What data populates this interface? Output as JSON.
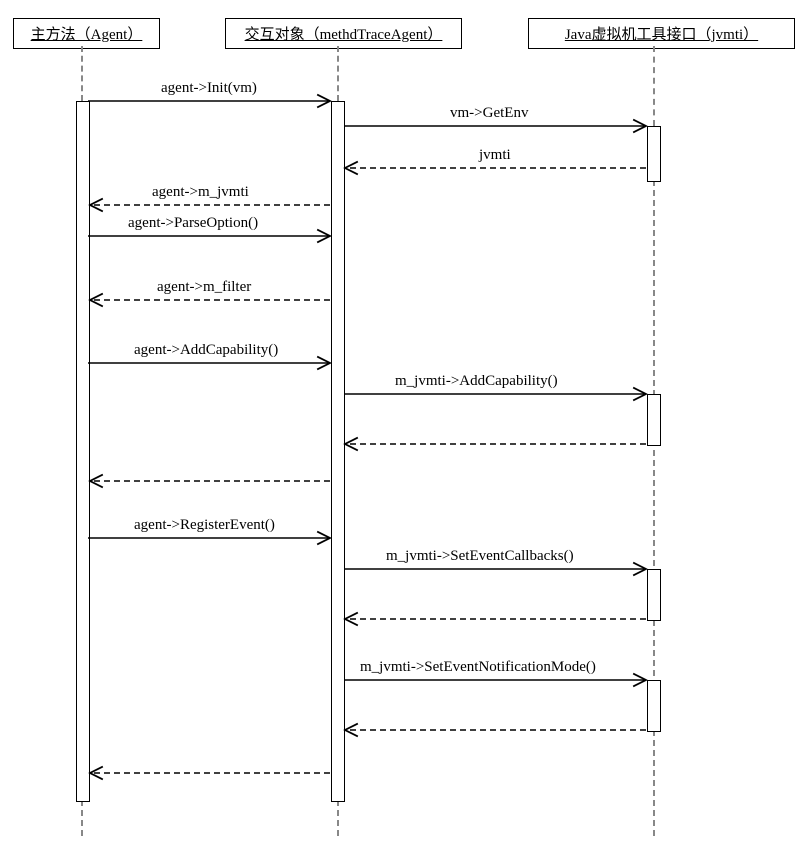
{
  "participants": {
    "agent": "主方法（Agent）",
    "trace": "交互对象（methdTraceAgent）",
    "jvmti": "Java虚拟机工具接口（jvmti）"
  },
  "messages": {
    "m1": "agent->Init(vm)",
    "m2": "vm->GetEnv",
    "m3": "jvmti",
    "m4": "agent->m_jvmti",
    "m5": "agent->ParseOption()",
    "m6": "agent->m_filter",
    "m7": "agent->AddCapability()",
    "m8": "m_jvmti->AddCapability()",
    "m9": "agent->RegisterEvent()",
    "m10": "m_jvmti->SetEventCallbacks()",
    "m11": "m_jvmti->SetEventNotificationMode()"
  }
}
